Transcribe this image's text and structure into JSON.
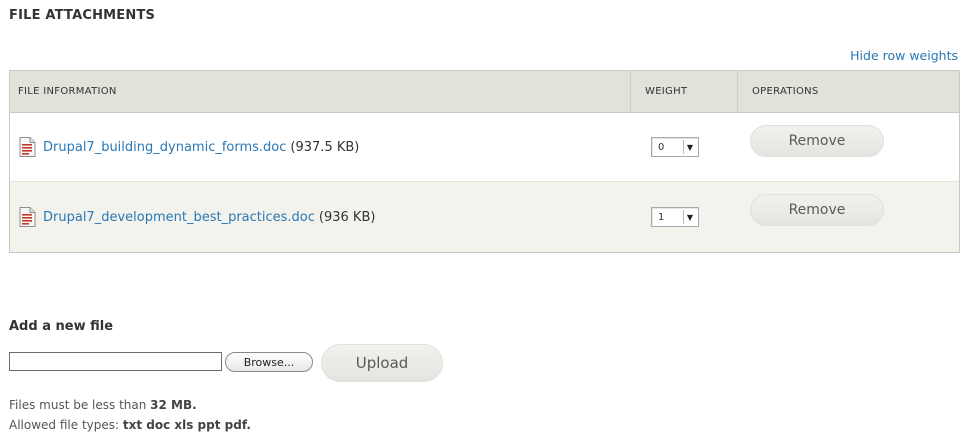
{
  "section": {
    "title": "FILE ATTACHMENTS",
    "toggle_weights_label": "Hide row weights"
  },
  "table": {
    "headers": {
      "file_information": "FILE INFORMATION",
      "weight": "WEIGHT",
      "operations": "OPERATIONS"
    },
    "rows": [
      {
        "icon": "document-icon",
        "filename": "Drupal7_building_dynamic_forms.doc",
        "size": "(937.5 KB)",
        "weight": "0",
        "remove_label": "Remove"
      },
      {
        "icon": "document-icon",
        "filename": "Drupal7_development_best_practices.doc",
        "size": "(936 KB)",
        "weight": "1",
        "remove_label": "Remove"
      }
    ]
  },
  "upload": {
    "title": "Add a new file",
    "file_value": "",
    "browse_label": "Browse...",
    "upload_label": "Upload",
    "help_size_prefix": "Files must be less than ",
    "help_size_value": "32 MB.",
    "help_types_prefix": "Allowed file types: ",
    "help_types_value": "txt doc xls ppt pdf."
  },
  "colors": {
    "link": "#2a78b5",
    "header_bg": "#e2e1da",
    "even_row_bg": "#f3f3ed",
    "button_bg": "#e8e8e4"
  }
}
